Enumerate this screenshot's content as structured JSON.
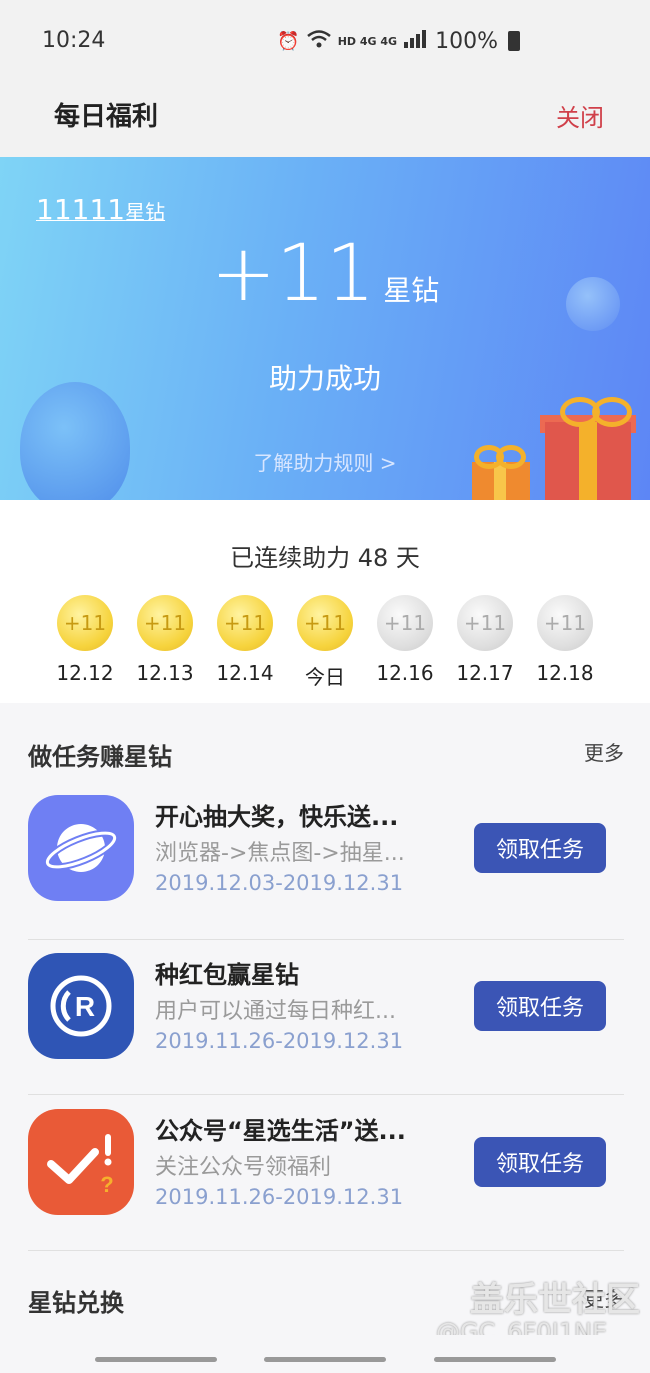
{
  "status": {
    "time": "10:24",
    "network": "HD 4G 4G",
    "battery": "100%"
  },
  "header": {
    "title": "每日福利",
    "close": "关闭"
  },
  "banner": {
    "balance_num": "11111",
    "balance_unit": "星钻",
    "amount": "+11",
    "amount_unit": "星钻",
    "success": "助力成功",
    "rules": "了解助力规则 >"
  },
  "streak": {
    "label": "已连续助力 48 天",
    "days": [
      {
        "coin": "+11",
        "date": "12.12",
        "state": "gold"
      },
      {
        "coin": "+11",
        "date": "12.13",
        "state": "gold"
      },
      {
        "coin": "+11",
        "date": "12.14",
        "state": "gold"
      },
      {
        "coin": "+11",
        "date": "今日",
        "state": "gold"
      },
      {
        "coin": "+11",
        "date": "12.16",
        "state": "grey"
      },
      {
        "coin": "+11",
        "date": "12.17",
        "state": "grey"
      },
      {
        "coin": "+11",
        "date": "12.18",
        "state": "grey"
      }
    ]
  },
  "tasks": {
    "section_title": "做任务赚星钻",
    "more": "更多",
    "items": [
      {
        "title": "开心抽大奖，快乐送...",
        "desc": "浏览器->焦点图->抽星...",
        "date": "2019.12.03-2019.12.31",
        "button": "领取任务",
        "icon": "browser-planet-icon",
        "color": "#6f7ff3"
      },
      {
        "title": "种红包赢星钻",
        "desc": "用户可以通过每日种红...",
        "date": "2019.11.26-2019.12.31",
        "button": "领取任务",
        "icon": "registered-r-icon",
        "color": "#2f55b5"
      },
      {
        "title": "公众号“星选生活”送...",
        "desc": "关注公众号领福利",
        "date": "2019.11.26-2019.12.31",
        "button": "领取任务",
        "icon": "check-question-icon",
        "color": "#e95a37"
      }
    ]
  },
  "exchange": {
    "section_title": "星钻兑换",
    "more": "更多"
  },
  "watermark": {
    "line1": "盖乐世社区",
    "line2": "@GC_6F0J1NE"
  }
}
